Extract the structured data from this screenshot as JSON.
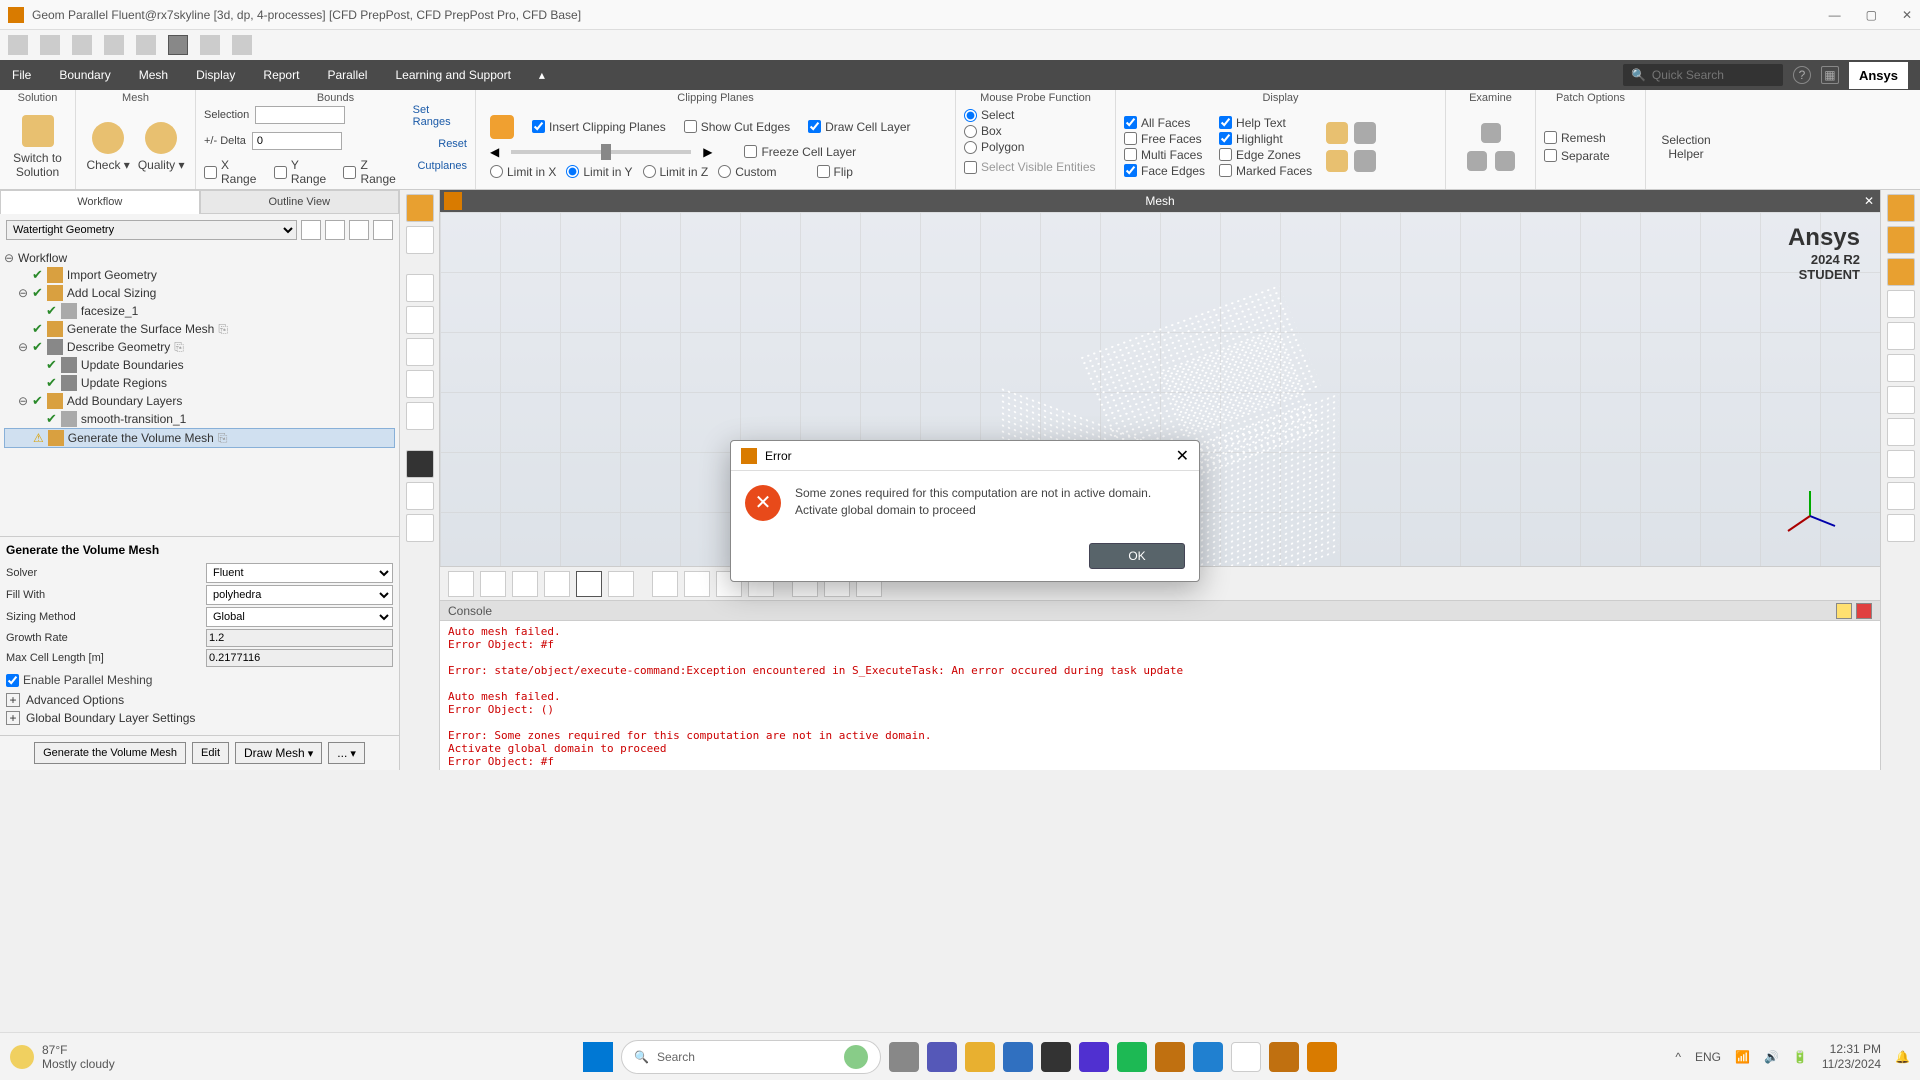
{
  "window": {
    "title": "Geom Parallel Fluent@rx7skyline  [3d, dp, 4-processes] [CFD PrepPost, CFD PrepPost Pro, CFD Base]"
  },
  "menu": {
    "file": "File",
    "boundary": "Boundary",
    "mesh": "Mesh",
    "display": "Display",
    "report": "Report",
    "parallel": "Parallel",
    "learning": "Learning and Support",
    "search_ph": "Quick Search",
    "brand": "Ansys"
  },
  "ribbon": {
    "solution": {
      "head": "Solution",
      "switch": "Switch to\nSolution"
    },
    "mesh_group": {
      "head": "Mesh",
      "check": "Check",
      "quality": "Quality"
    },
    "bounds": {
      "head": "Bounds",
      "selection": "Selection",
      "delta": "+/- Delta",
      "delta_val": "0",
      "set": "Set Ranges",
      "reset": "Reset",
      "xr": "X Range",
      "yr": "Y Range",
      "zr": "Z Range",
      "cut": "Cutplanes"
    },
    "clip": {
      "head": "Clipping Planes",
      "insert": "Insert Clipping Planes",
      "showcut": "Show Cut Edges",
      "drawcell": "Draw Cell Layer",
      "freeze": "Freeze Cell Layer",
      "flip": "Flip",
      "limx": "Limit in X",
      "limy": "Limit in Y",
      "limz": "Limit in Z",
      "custom": "Custom"
    },
    "mouse": {
      "head": "Mouse Probe Function",
      "select": "Select",
      "box": "Box",
      "polygon": "Polygon",
      "selvis": "Select Visible Entities"
    },
    "display": {
      "head": "Display",
      "allfaces": "All Faces",
      "freefaces": "Free Faces",
      "multifaces": "Multi Faces",
      "faceedges": "Face Edges",
      "helptext": "Help Text",
      "highlight": "Highlight",
      "edgezones": "Edge Zones",
      "markedfaces": "Marked Faces"
    },
    "examine": {
      "head": "Examine"
    },
    "patch": {
      "head": "Patch Options",
      "remesh": "Remesh",
      "separate": "Separate"
    },
    "selhelp": {
      "head": "Selection\nHelper"
    }
  },
  "tabs": {
    "workflow": "Workflow",
    "outline": "Outline View"
  },
  "combo": {
    "wt": "Watertight Geometry"
  },
  "tree": {
    "root": "Workflow",
    "n1": "Import Geometry",
    "n2": "Add Local Sizing",
    "n2a": "facesize_1",
    "n3": "Generate the Surface Mesh",
    "n4": "Describe Geometry",
    "n4a": "Update Boundaries",
    "n4b": "Update Regions",
    "n5": "Add Boundary Layers",
    "n5a": "smooth-transition_1",
    "n6": "Generate the Volume Mesh"
  },
  "props": {
    "head": "Generate the Volume Mesh",
    "solver_l": "Solver",
    "solver_v": "Fluent",
    "fill_l": "Fill With",
    "fill_v": "polyhedra",
    "sizing_l": "Sizing Method",
    "sizing_v": "Global",
    "growth_l": "Growth Rate",
    "growth_v": "1.2",
    "maxcell_l": "Max Cell Length [m]",
    "maxcell_v": "0.2177116",
    "parallel": "Enable Parallel Meshing",
    "adv": "Advanced Options",
    "global": "Global Boundary Layer Settings"
  },
  "btns": {
    "gen": "Generate the Volume Mesh",
    "edit": "Edit",
    "draw": "Draw Mesh",
    "more": "..."
  },
  "viewport": {
    "title": "Mesh",
    "brand": "Ansys",
    "ver": "2024 R2",
    "student": "STUDENT"
  },
  "console": {
    "head": "Console",
    "text": "Auto mesh failed.\nError Object: #f\n\nError: state/object/execute-command:Exception encountered in S_ExecuteTask: An error occured during task update\n\nAuto mesh failed.\nError Object: ()\n\nError: Some zones required for this computation are not in active domain.\nActivate global domain to proceed\nError Object: #f"
  },
  "dialog": {
    "title": "Error",
    "msg": "Some zones required for this computation are not in active domain.\nActivate global domain to proceed",
    "ok": "OK"
  },
  "taskbar": {
    "temp": "87°F",
    "cond": "Mostly cloudy",
    "search": "Search",
    "lang": "ENG",
    "time": "12:31 PM",
    "date": "11/23/2024"
  }
}
